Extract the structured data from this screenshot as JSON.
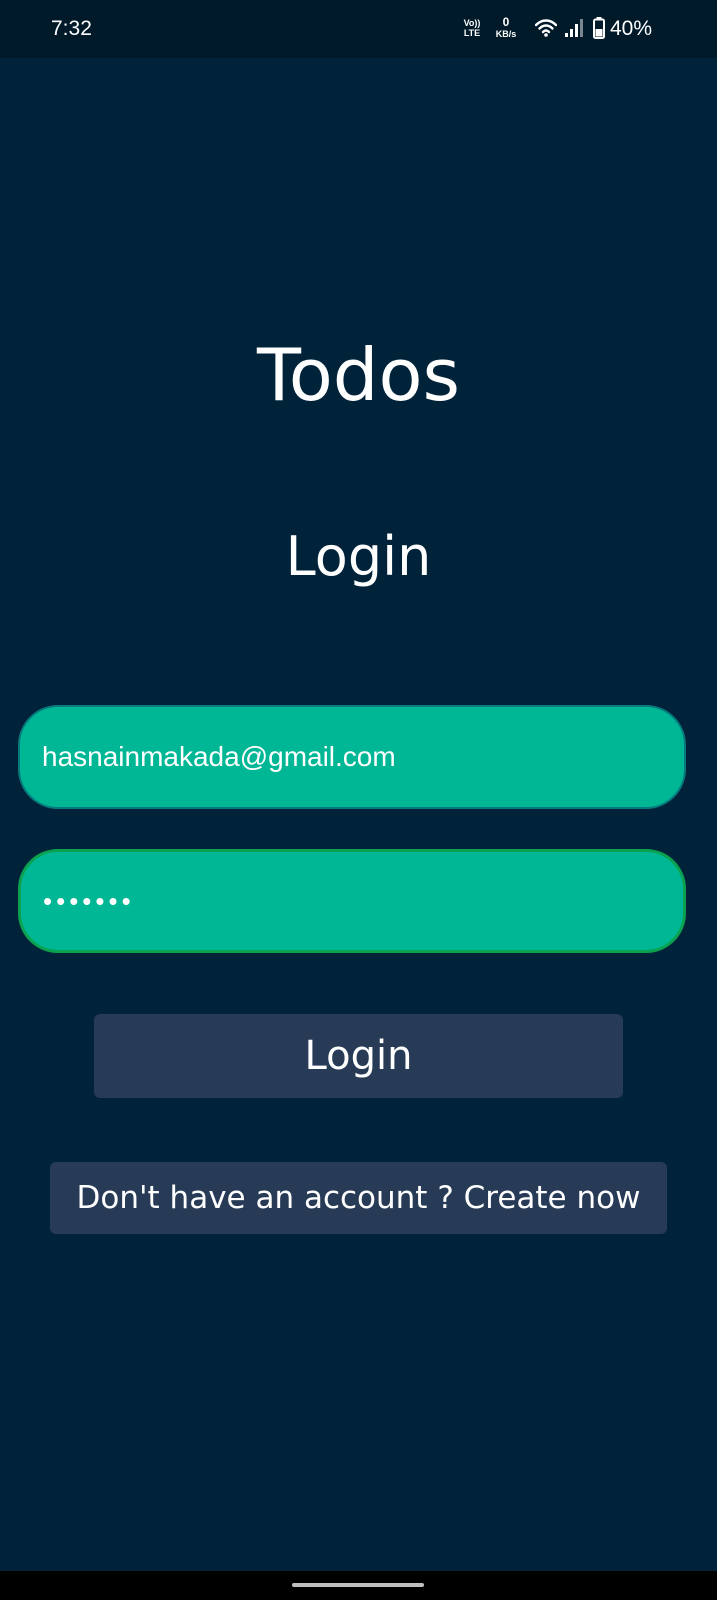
{
  "status_bar": {
    "time": "7:32",
    "volte_top": "Vo))",
    "volte_bottom": "LTE",
    "net_speed_value": "0",
    "net_speed_unit": "KB/s",
    "battery": "40%",
    "icons": [
      "wifi-icon",
      "signal-icon",
      "battery-icon"
    ]
  },
  "app": {
    "title": "Todos",
    "screen_title": "Login"
  },
  "form": {
    "email_value": "hasnainmakada@gmail.com",
    "password_mask": "•••••••",
    "login_label": "Login",
    "create_account_label": "Don't have an account ? Create now"
  },
  "colors": {
    "background": "#00233a",
    "status_bar": "#001a2a",
    "field_fill": "#00b795",
    "field_border": "#077a7e",
    "field_focus_border": "#0aa24e",
    "button": "#273b57",
    "text": "#ffffff"
  }
}
